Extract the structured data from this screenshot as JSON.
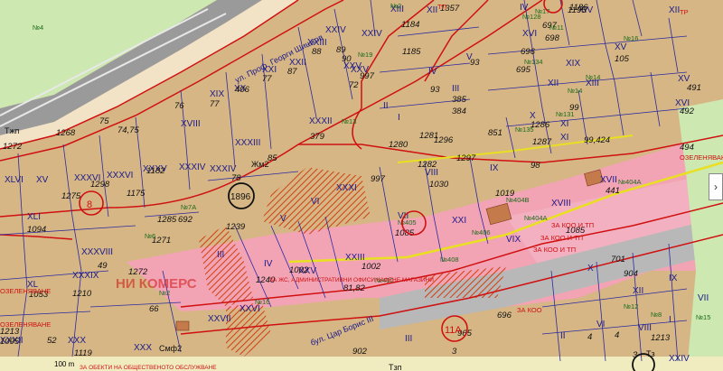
{
  "map": {
    "street_name": "ул. Проф. Георги Шишков",
    "street_name_2": "бул. Цар Борис III",
    "zone_label": "НИ КОМЕРС",
    "zoning": [
      "ОЗЕЛЕНЯВАНЕ",
      "ОЗЕЛЕНЯВАНЕ",
      "ОЗЕЛЕНЯВАНЕ",
      "ЗА КОО И ТП",
      "ЗА КОО И ТП",
      "ЗА КОО И ТП",
      "ЗА КОО",
      "ТП",
      "ТР"
    ],
    "short_codes": [
      "Тжп",
      "Жм2",
      "Смф2",
      "Тзп",
      "Тз"
    ],
    "mixed_use": "ЗА ЖС, АДМИНИСТРАТИВНИ ОФИСИ КАФЕНЕ МАГАЗИНИ",
    "bottom_text": "ЗА ОБЕКТИ НА ОБЩЕСТВЕНОТО ОБСЛУЖВАНЕ",
    "circled": [
      "8",
      "1896",
      "11А"
    ],
    "scale": "100 m",
    "nav_arrow": "›"
  }
}
